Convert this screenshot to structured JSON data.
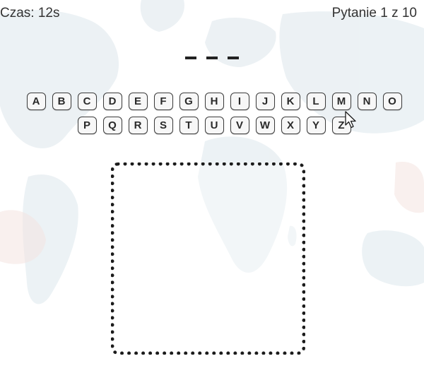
{
  "header": {
    "timer": "Czas: 12s",
    "question_counter": "Pytanie 1 z 10"
  },
  "answer": {
    "slots": [
      "",
      "",
      ""
    ]
  },
  "keyboard": {
    "row1": [
      "A",
      "B",
      "C",
      "D",
      "E",
      "F",
      "G",
      "H",
      "I",
      "J",
      "K",
      "L",
      "M",
      "N",
      "O"
    ],
    "row2": [
      "P",
      "Q",
      "R",
      "S",
      "T",
      "U",
      "V",
      "W",
      "X",
      "Y",
      "Z"
    ]
  },
  "colors": {
    "key_border": "#3c3c3c",
    "key_bg": "#f7f7f7",
    "box_border": "#1c1c1c",
    "map_tint": "#e7eef2"
  },
  "icons": {
    "cursor": "mouse-pointer-icon",
    "background": "world-map-icon"
  }
}
